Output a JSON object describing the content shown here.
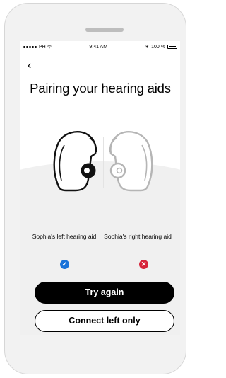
{
  "status_bar": {
    "carrier": "PH",
    "time": "9:41 AM",
    "battery": "100 %"
  },
  "nav": {
    "back_icon": "chevron-left-icon",
    "back_glyph": "‹"
  },
  "screen": {
    "title": "Pairing your hearing aids"
  },
  "devices": {
    "left": {
      "label": "Sophia's left hearing aid",
      "status": "paired",
      "status_icon": "check-circle-icon",
      "status_glyph": "✓",
      "color": "#1a73d9"
    },
    "right": {
      "label": "Sophia's right hearing aid",
      "status": "failed",
      "status_icon": "x-circle-icon",
      "status_glyph": "✕",
      "color": "#d6243a"
    }
  },
  "actions": {
    "primary": "Try again",
    "secondary": "Connect left only"
  }
}
